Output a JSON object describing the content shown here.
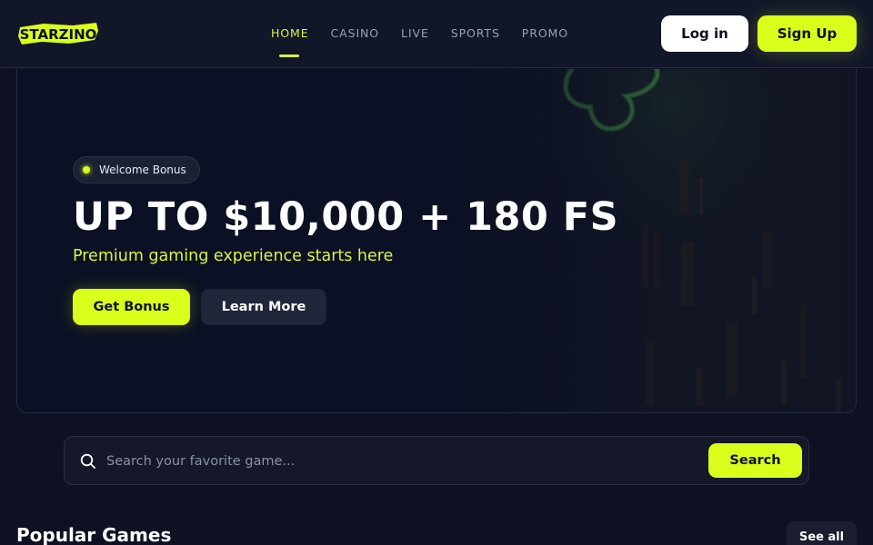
{
  "header": {
    "logo_text": "STARZINO",
    "nav": [
      {
        "label": "HOME",
        "active": true
      },
      {
        "label": "CASINO",
        "active": false
      },
      {
        "label": "LIVE",
        "active": false
      },
      {
        "label": "SPORTS",
        "active": false
      },
      {
        "label": "PROMO",
        "active": false
      }
    ],
    "login_label": "Log in",
    "signup_label": "Sign Up"
  },
  "hero": {
    "badge": "Welcome Bonus",
    "title": "UP TO $10,000 + 180 FS",
    "subtitle": "Premium gaming experience starts here",
    "primary_button": "Get Bonus",
    "secondary_button": "Learn More"
  },
  "search": {
    "placeholder": "Search your favorite game...",
    "value": "",
    "button_label": "Search",
    "icon": "search-icon"
  },
  "popular": {
    "title": "Popular Games",
    "see_all_label": "See all"
  },
  "colors": {
    "accent": "#d9ff1a",
    "background": "#0e1122",
    "header": "#121629"
  }
}
